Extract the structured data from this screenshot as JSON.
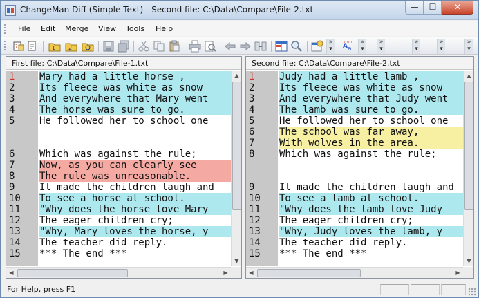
{
  "window": {
    "title": "ChangeMan Diff (Simple Text) - Second file: C:\\Data\\Compare\\File-2.txt",
    "controls": {
      "minimize": "—",
      "maximize": "☐",
      "close": "✕"
    }
  },
  "menu": {
    "items": [
      "File",
      "Edit",
      "Merge",
      "View",
      "Tools",
      "Help"
    ]
  },
  "toolbar": {
    "icons": [
      "open-files-icon",
      "open-first-file-icon",
      "open-second-file-icon",
      "open-compare-icon",
      "save-icon",
      "save-all-icon",
      "cut-icon",
      "copy-icon",
      "paste-icon",
      "print-icon",
      "print-preview-icon",
      "previous-difference-icon",
      "next-difference-icon",
      "merge-icon",
      "view-layout-icon",
      "find-icon",
      "options-icon",
      "font-icon"
    ]
  },
  "left_pane": {
    "header": "First file: C:\\Data\\Compare\\File-1.txt",
    "rows": [
      {
        "num": "1",
        "text": "Mary had a little horse ,",
        "state": "mod"
      },
      {
        "num": "2",
        "text": "Its fleece was white as snow",
        "state": "mod"
      },
      {
        "num": "3",
        "text": "And everywhere that Mary went",
        "state": "mod"
      },
      {
        "num": "4",
        "text": "The horse was sure to go.",
        "state": "mod"
      },
      {
        "num": "5",
        "text": "He followed her to school one",
        "state": ""
      },
      {
        "num": "",
        "text": "",
        "state": "gap"
      },
      {
        "num": "",
        "text": "",
        "state": "gap"
      },
      {
        "num": "6",
        "text": "Which was against the rule;",
        "state": ""
      },
      {
        "num": "7",
        "text": "Now, as you can clearly see",
        "state": "del"
      },
      {
        "num": "8",
        "text": "The rule was unreasonable.",
        "state": "del"
      },
      {
        "num": "9",
        "text": "It made the children laugh and",
        "state": ""
      },
      {
        "num": "10",
        "text": "To see a horse at school.",
        "state": "mod"
      },
      {
        "num": "11",
        "text": "\"Why does the horse love Mary",
        "state": "mod"
      },
      {
        "num": "12",
        "text": "The eager children cry;",
        "state": ""
      },
      {
        "num": "13",
        "text": "\"Why, Mary loves the horse, y",
        "state": "mod"
      },
      {
        "num": "14",
        "text": "The teacher did reply.",
        "state": ""
      },
      {
        "num": "15",
        "text": "*** The end ***",
        "state": ""
      }
    ]
  },
  "right_pane": {
    "header": "Second file: C:\\Data\\Compare\\File-2.txt",
    "rows": [
      {
        "num": "1",
        "text": "Judy had a little lamb ,",
        "state": "mod"
      },
      {
        "num": "2",
        "text": "Its fleece was white as snow",
        "state": "mod"
      },
      {
        "num": "3",
        "text": "And everywhere that Judy went",
        "state": "mod"
      },
      {
        "num": "4",
        "text": "The lamb was sure to go.",
        "state": "mod"
      },
      {
        "num": "5",
        "text": "He followed her to school one",
        "state": ""
      },
      {
        "num": "6",
        "text": "The school was far away,",
        "state": "add"
      },
      {
        "num": "7",
        "text": "With wolves in the area.",
        "state": "add"
      },
      {
        "num": "8",
        "text": "Which was against the rule;",
        "state": ""
      },
      {
        "num": "",
        "text": "",
        "state": "gap"
      },
      {
        "num": "",
        "text": "",
        "state": "gap"
      },
      {
        "num": "9",
        "text": "It made the children laugh and",
        "state": ""
      },
      {
        "num": "10",
        "text": "To see a lamb at school.",
        "state": "mod"
      },
      {
        "num": "11",
        "text": "\"Why does the lamb love Judy",
        "state": "mod"
      },
      {
        "num": "12",
        "text": "The eager children cry;",
        "state": ""
      },
      {
        "num": "13",
        "text": "\"Why, Judy loves the lamb, y",
        "state": "mod"
      },
      {
        "num": "14",
        "text": "The teacher did reply.",
        "state": ""
      },
      {
        "num": "15",
        "text": "*** The end ***",
        "state": ""
      }
    ]
  },
  "colors": {
    "changed": "#aee8ef",
    "deleted": "#f5a9a3",
    "inserted": "#f7f0a2",
    "placeholder": "#dcdcdc",
    "gutter": "#c8c8c8"
  },
  "status": {
    "text": "For Help, press F1"
  }
}
